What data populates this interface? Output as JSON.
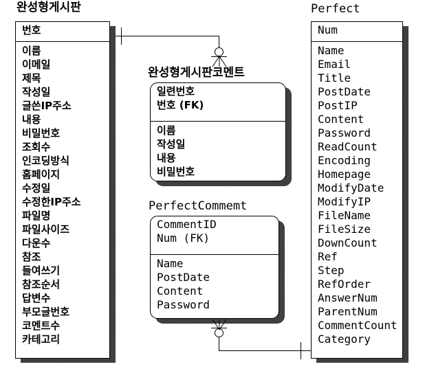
{
  "diagram": {
    "type": "entity-relationship-diagram",
    "notation": "crow's foot",
    "entities": [
      {
        "id": "board_kr",
        "name": "완성형게시판",
        "script": "korean",
        "shape": "square",
        "primary_keys": [
          "번호"
        ],
        "attributes": [
          "이름",
          "이메일",
          "제목",
          "작성일",
          "글쓴IP주소",
          "내용",
          "비밀번호",
          "조회수",
          "인코딩방식",
          "홈페이지",
          "수정일",
          "수정한IP주소",
          "파일명",
          "파일사이즈",
          "다운수",
          "참조",
          "들여쓰기",
          "참조순서",
          "답변수",
          "부모글번호",
          "코멘트수",
          "카테고리"
        ]
      },
      {
        "id": "board_comment_kr",
        "name": "완성형게시판코멘트",
        "script": "korean",
        "shape": "rounded",
        "primary_keys": [
          "일련번호",
          "번호 (FK)"
        ],
        "attributes": [
          "이름",
          "작성일",
          "내용",
          "비밀번호"
        ]
      },
      {
        "id": "perfect_comment",
        "name": "PerfectCommemt",
        "script": "latin",
        "shape": "rounded",
        "primary_keys": [
          "CommentID",
          "Num (FK)"
        ],
        "attributes": [
          "Name",
          "PostDate",
          "Content",
          "Password"
        ]
      },
      {
        "id": "perfect",
        "name": "Perfect",
        "script": "latin",
        "shape": "square",
        "primary_keys": [
          "Num"
        ],
        "attributes": [
          "Name",
          "Email",
          "Title",
          "PostDate",
          "PostIP",
          "Content",
          "Password",
          "ReadCount",
          "Encoding",
          "Homepage",
          "ModifyDate",
          "ModifyIP",
          "FileName",
          "FileSize",
          "DownCount",
          "Ref",
          "Step",
          "RefOrder",
          "AnswerNum",
          "ParentNum",
          "CommentCount",
          "Category"
        ]
      }
    ],
    "relationships": [
      {
        "id": "rel_kr",
        "from": "board_kr",
        "to": "board_comment_kr",
        "from_cardinality": "one",
        "to_cardinality": "zero-or-many"
      },
      {
        "id": "rel_en",
        "from": "perfect",
        "to": "perfect_comment",
        "from_cardinality": "one",
        "to_cardinality": "zero-or-many"
      }
    ],
    "colors": {
      "line": "#000000",
      "fill": "#ffffff",
      "text": "#000000",
      "shadow": "#808080"
    }
  }
}
